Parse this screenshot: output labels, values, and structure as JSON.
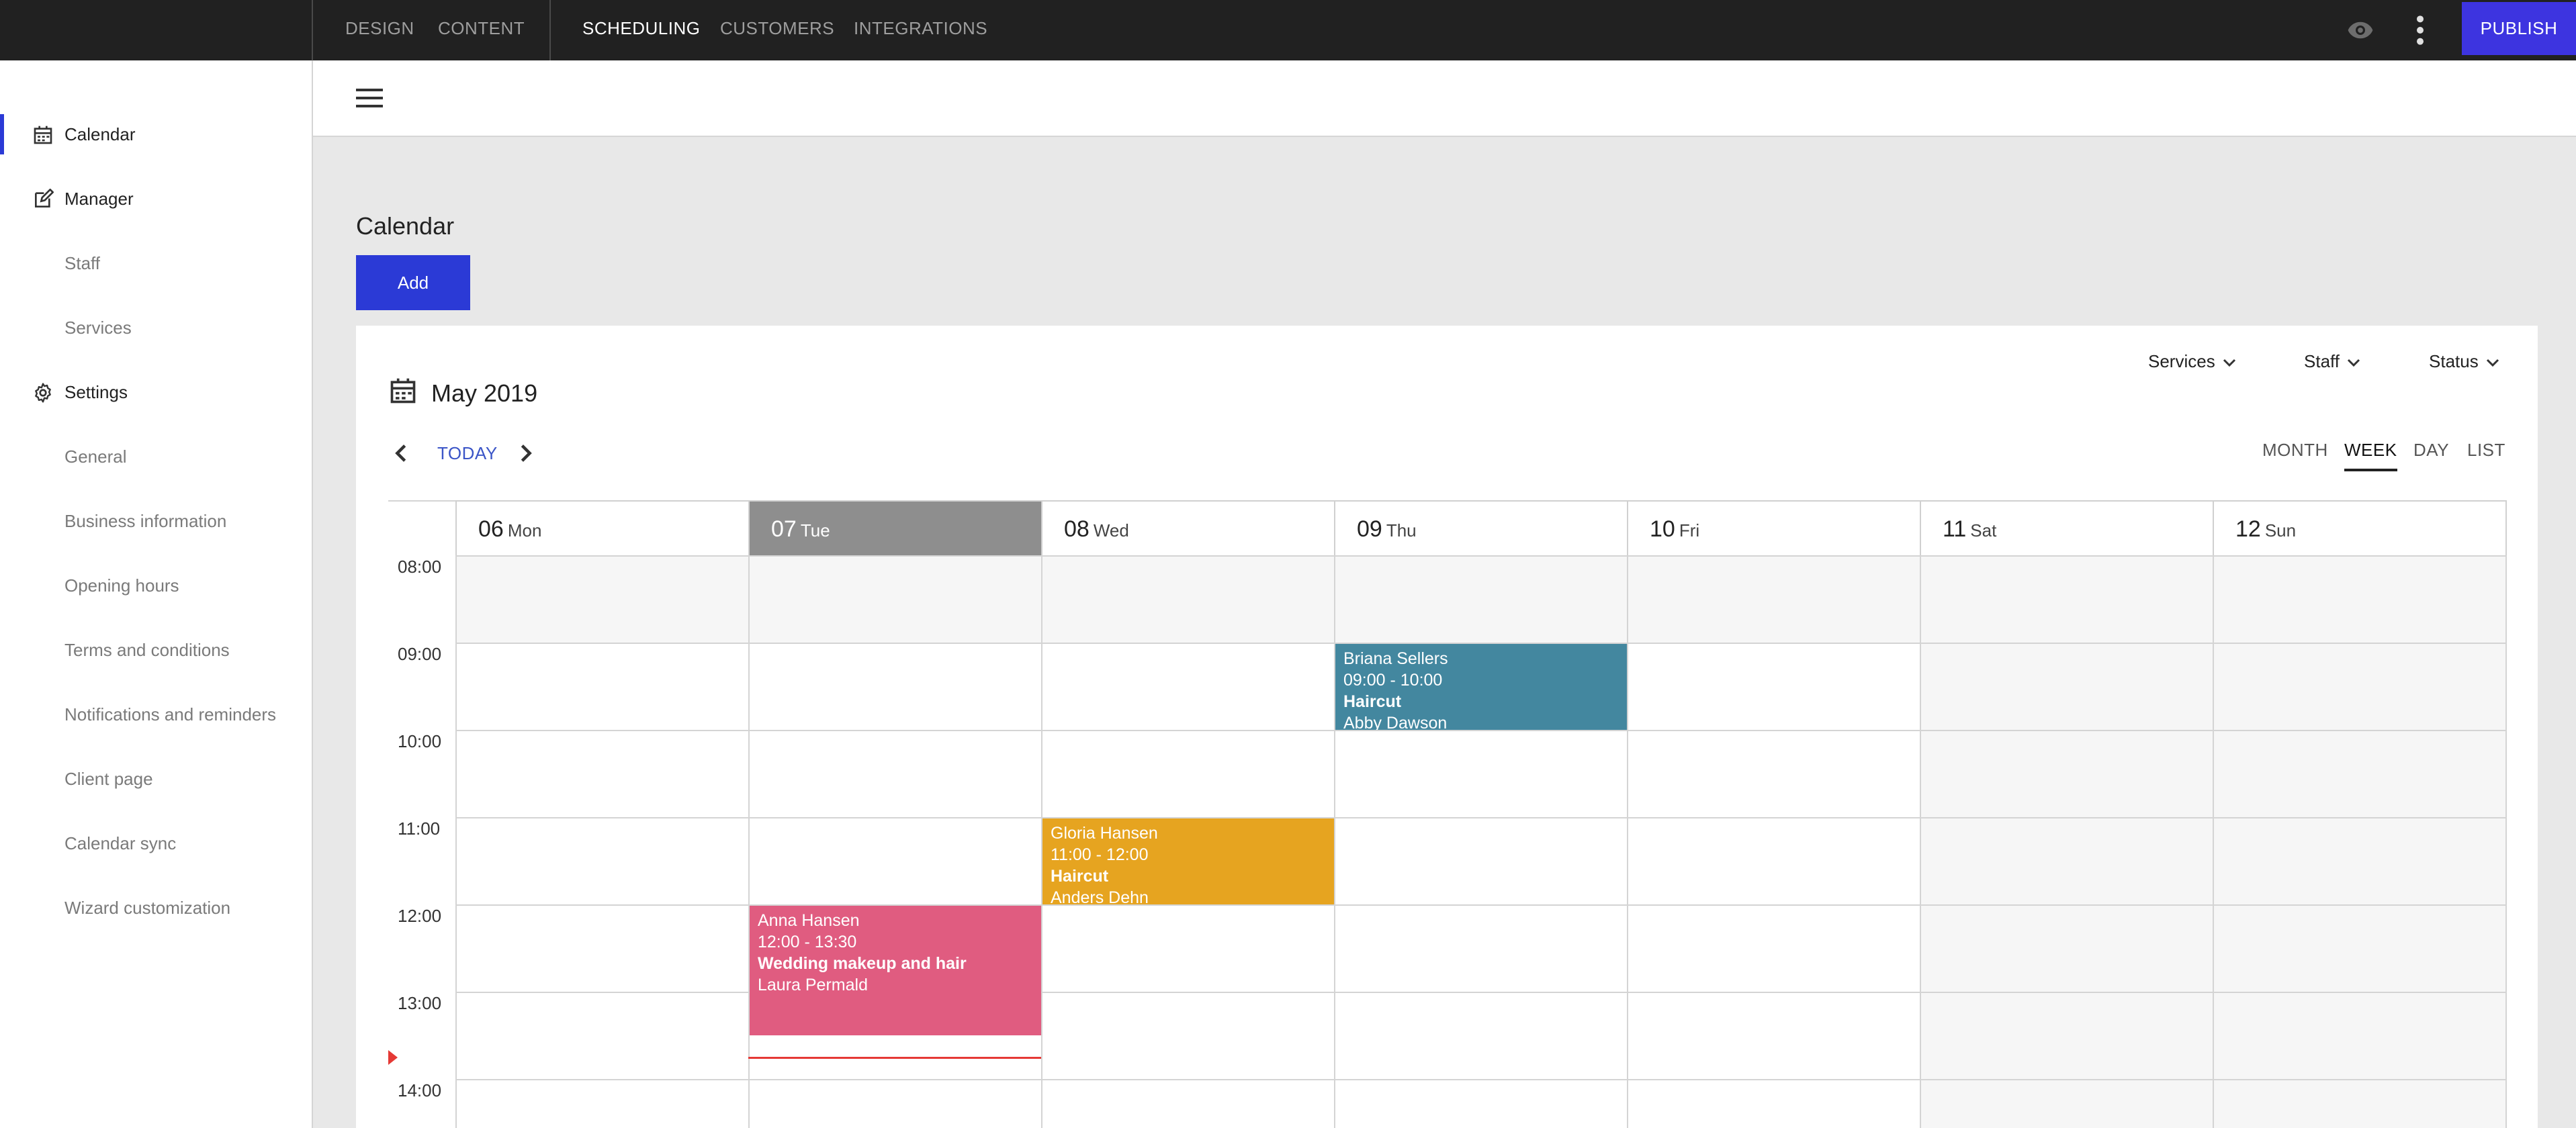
{
  "topbar": {
    "tabs": [
      {
        "label": "DESIGN",
        "active": false
      },
      {
        "label": "CONTENT",
        "active": false
      },
      {
        "label": "SCHEDULING",
        "active": true
      },
      {
        "label": "CUSTOMERS",
        "active": false
      },
      {
        "label": "INTEGRATIONS",
        "active": false
      }
    ],
    "preview_icon": "eye-icon",
    "more_icon": "more-vertical-icon",
    "publish_label": "PUBLISH",
    "publish_color": "#3d34e0"
  },
  "sidebar": {
    "items": [
      {
        "label": "Calendar",
        "icon": "calendar-icon",
        "level": "top",
        "active": true
      },
      {
        "label": "Manager",
        "icon": "edit-icon",
        "level": "top",
        "active": false
      },
      {
        "label": "Staff",
        "level": "sub"
      },
      {
        "label": "Services",
        "level": "sub"
      },
      {
        "label": "Settings",
        "icon": "gear-icon",
        "level": "top",
        "active": false
      },
      {
        "label": "General",
        "level": "sub"
      },
      {
        "label": "Business information",
        "level": "sub"
      },
      {
        "label": "Opening hours",
        "level": "sub"
      },
      {
        "label": "Terms and conditions",
        "level": "sub"
      },
      {
        "label": "Notifications and reminders",
        "level": "sub"
      },
      {
        "label": "Client page",
        "level": "sub"
      },
      {
        "label": "Calendar sync",
        "level": "sub"
      },
      {
        "label": "Wizard customization",
        "level": "sub"
      }
    ],
    "accent_color": "#2b3ad6"
  },
  "header": {
    "menu_icon": "hamburger-menu-icon"
  },
  "page": {
    "title": "Calendar",
    "add_label": "Add",
    "add_color": "#2b3ad6"
  },
  "calendar": {
    "month_title": "May 2019",
    "today_label": "TODAY",
    "filters": [
      "Services",
      "Staff",
      "Status"
    ],
    "views": [
      {
        "label": "MONTH",
        "active": false
      },
      {
        "label": "WEEK",
        "active": true
      },
      {
        "label": "DAY",
        "active": false
      },
      {
        "label": "LIST",
        "active": false
      }
    ],
    "days": [
      {
        "num": "06",
        "name": "Mon",
        "today": false
      },
      {
        "num": "07",
        "name": "Tue",
        "today": true
      },
      {
        "num": "08",
        "name": "Wed",
        "today": false
      },
      {
        "num": "09",
        "name": "Thu",
        "today": false
      },
      {
        "num": "10",
        "name": "Fri",
        "today": false
      },
      {
        "num": "11",
        "name": "Sat",
        "today": false
      },
      {
        "num": "12",
        "name": "Sun",
        "today": false
      }
    ],
    "hours": [
      "08:00",
      "09:00",
      "10:00",
      "11:00",
      "12:00",
      "13:00",
      "14:00"
    ],
    "current_time": "13:45",
    "events": [
      {
        "customer": "Briana Sellers",
        "time": "09:00 - 10:00",
        "service": "Haircut",
        "staff": "Abby Dawson",
        "day": 3,
        "start": 9,
        "end": 10,
        "color": "#43879f"
      },
      {
        "customer": "Gloria Hansen",
        "time": "11:00 - 12:00",
        "service": "Haircut",
        "staff": "Anders Dehn",
        "day": 2,
        "start": 11,
        "end": 12,
        "color": "#e6a420"
      },
      {
        "customer": "Anna Hansen",
        "time": "12:00 - 13:30",
        "service": "Wedding makeup and hair",
        "staff": "Laura Permald",
        "day": 1,
        "start": 12,
        "end": 13.5,
        "color": "#e05c80"
      }
    ]
  }
}
